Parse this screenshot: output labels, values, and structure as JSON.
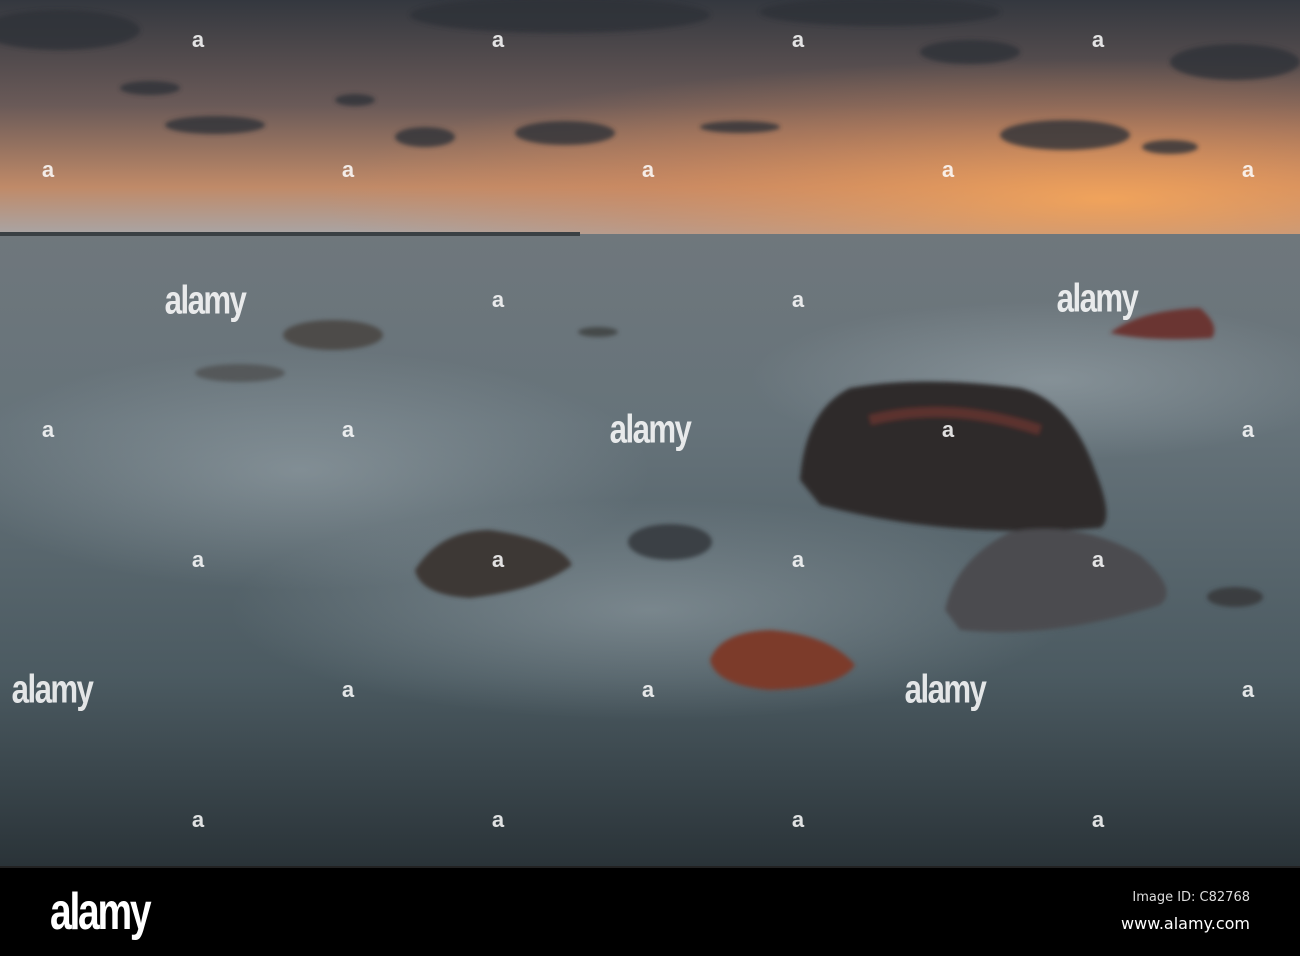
{
  "photo": {
    "subject": "Long-exposure seascape at sunset with boulders",
    "colors": {
      "sky_top": "#3b3f4a",
      "sky_glow": "#e89a58",
      "sea": "#5e6a72",
      "sea_dark": "#2c353b",
      "rock": "#2d2828",
      "rock_red": "#8a3a28"
    }
  },
  "watermark": {
    "glyph": "a",
    "logo": "alamy"
  },
  "footer": {
    "logo": "alamy",
    "image_id": "Image ID: C82768",
    "url": "www.alamy.com"
  }
}
